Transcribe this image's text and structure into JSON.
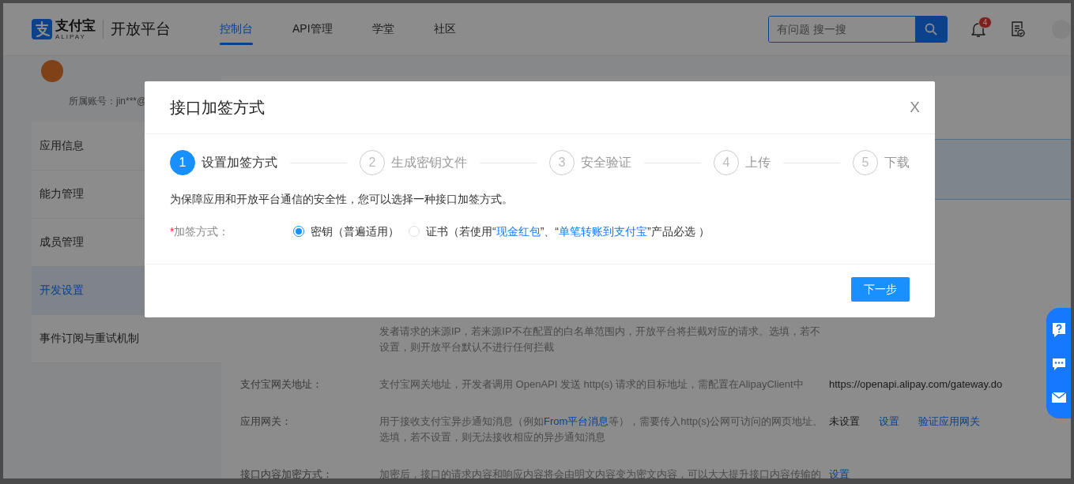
{
  "header": {
    "logo_text": "支付宝",
    "logo_sub": "ALIPAY",
    "platform": "开放平台",
    "nav": [
      {
        "label": "控制台",
        "selected": true
      },
      {
        "label": "API管理",
        "selected": false
      },
      {
        "label": "学堂",
        "selected": false
      },
      {
        "label": "社区",
        "selected": false
      }
    ],
    "search": {
      "placeholder": "有问题 搜一搜"
    },
    "notification_badge": "4"
  },
  "account": {
    "text": "所属账号：jin***@"
  },
  "sidebar": {
    "items": [
      {
        "label": "应用信息",
        "selected": false
      },
      {
        "label": "能力管理",
        "selected": false
      },
      {
        "label": "成员管理",
        "selected": false
      },
      {
        "label": "开发设置",
        "selected": true
      },
      {
        "label": "事件订阅与重试机制",
        "selected": false
      }
    ]
  },
  "settings": {
    "rows": [
      {
        "description": [
          {
            "text": "发者请求的来源IP，若来源IP不在配置的白名单范围内，开放平台将拦截对应的请求。选填，若不设置，则开放平台默认不进行任何拦截"
          }
        ]
      },
      {
        "label": "支付宝网关地址：",
        "description": [
          {
            "text": "支付宝网关地址，开发者调用 OpenAPI 发送 http(s) 请求的目标地址，需配置在AlipayClient中"
          }
        ],
        "value": "https://openapi.alipay.com/gateway.do"
      },
      {
        "label": "应用网关：",
        "description": [
          {
            "text": "用于接收支付宝异步通知消息（例如"
          },
          {
            "text": "From平台消息",
            "link": true
          },
          {
            "text": "等），需要传入http(s)公网可访问的网页地址。选填，若不设置，则无法接收相应的异步通知消息"
          }
        ],
        "value": "未设置",
        "actions": [
          "设置",
          "验证应用网关"
        ]
      },
      {
        "label": "接口内容加密方式：",
        "description": [
          {
            "text": "加密后，接口的请求内容和响应内容将会由明文内容变为密文内容，可以大大提升接口内容传输的"
          }
        ],
        "actions": [
          "设置"
        ]
      }
    ]
  },
  "modal": {
    "title": "接口加签方式",
    "close": "X",
    "steps": [
      {
        "number": "1",
        "label": "设置加签方式",
        "active": true
      },
      {
        "number": "2",
        "label": "生成密钥文件",
        "active": false
      },
      {
        "number": "3",
        "label": "安全验证",
        "active": false
      },
      {
        "number": "4",
        "label": "上传",
        "active": false
      },
      {
        "number": "5",
        "label": "下载",
        "active": false
      }
    ],
    "intro": "为保障应用和开放平台通信的安全性，您可以选择一种接口加签方式。",
    "field": {
      "required_mark": "*",
      "label": "加签方式：",
      "options": [
        {
          "label": [
            {
              "text": "密钥（普遍适用）"
            }
          ],
          "selected": true
        },
        {
          "label": [
            {
              "text": "证书（若使用“"
            },
            {
              "text": "现金红包",
              "link": true
            },
            {
              "text": "”、“"
            },
            {
              "text": "单笔转账到支付宝",
              "link": true
            },
            {
              "text": "”产品必选 ）"
            }
          ],
          "selected": false
        }
      ]
    },
    "button": "下一步"
  }
}
